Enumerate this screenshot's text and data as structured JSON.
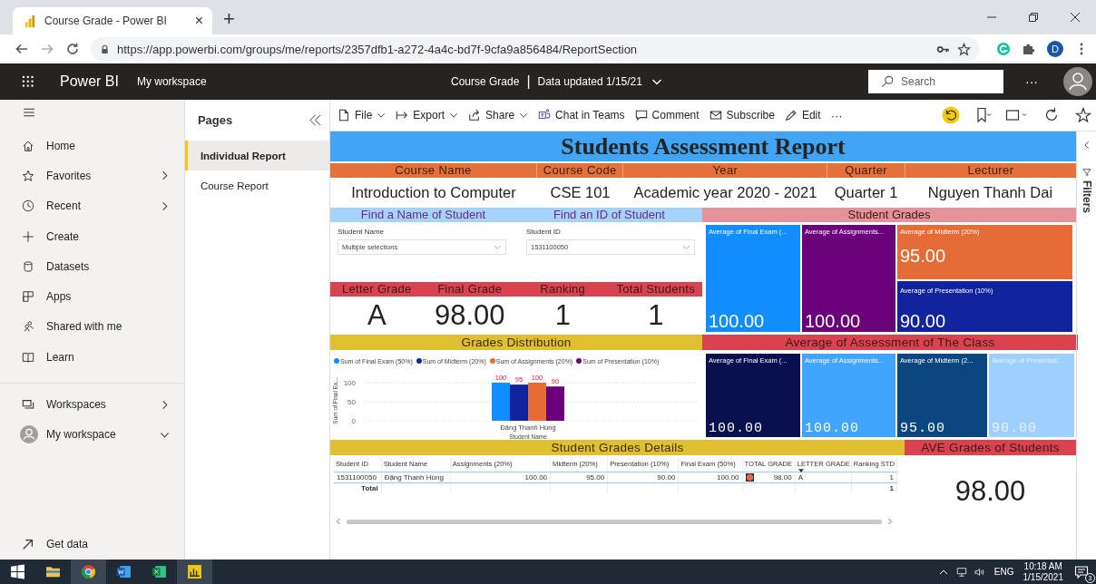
{
  "browser": {
    "tab_title": "Course Grade - Power BI",
    "tab_close": "×",
    "new_tab": "+",
    "url": "https://app.powerbi.com/groups/me/reports/2357dfb1-a272-4a4c-bd7f-9cfa9a856484/ReportSection",
    "profile_initial": "D"
  },
  "header": {
    "app_name": "Power BI",
    "workspace": "My workspace",
    "report_name": "Course Grade",
    "separator": "|",
    "data_updated": "Data updated 1/15/21",
    "search": {
      "placeholder": "Search"
    },
    "more": "···"
  },
  "nav": {
    "items": [
      {
        "label": "Home",
        "expandable": false
      },
      {
        "label": "Favorites",
        "expandable": true
      },
      {
        "label": "Recent",
        "expandable": true
      },
      {
        "label": "Create",
        "expandable": false
      },
      {
        "label": "Datasets",
        "expandable": false
      },
      {
        "label": "Apps",
        "expandable": false
      },
      {
        "label": "Shared with me",
        "expandable": false
      },
      {
        "label": "Learn",
        "expandable": false
      }
    ],
    "workspace_items": [
      {
        "label": "Workspaces",
        "expanded": false
      },
      {
        "label": "My workspace",
        "expanded": true
      }
    ],
    "footer": "Get data"
  },
  "pages": {
    "title": "Pages",
    "items": [
      {
        "label": "Individual Report",
        "selected": true
      },
      {
        "label": "Course Report",
        "selected": false
      }
    ]
  },
  "toolbar": {
    "items": [
      {
        "label": "File",
        "dropdown": true
      },
      {
        "label": "Export",
        "dropdown": true
      },
      {
        "label": "Share",
        "dropdown": true
      },
      {
        "label": "Chat in Teams",
        "dropdown": false
      },
      {
        "label": "Comment",
        "dropdown": false
      },
      {
        "label": "Subscribe",
        "dropdown": false
      },
      {
        "label": "Edit",
        "dropdown": false
      }
    ],
    "more": "···"
  },
  "filters_pane": {
    "label": "Filters"
  },
  "report": {
    "title": "Students Assessment Report",
    "course_info": [
      {
        "heading": "Course Name",
        "value": "Introduction to Computer"
      },
      {
        "heading": "Course Code",
        "value": "CSE 101"
      },
      {
        "heading": "Year",
        "value": "Academic year 2020 - 2021"
      },
      {
        "heading": "Quarter",
        "value": "Quarter 1"
      },
      {
        "heading": "Lecturer",
        "value": "Nguyen Thanh Dai"
      }
    ],
    "slicers": [
      {
        "heading": "Find a Name of Student",
        "label": "Student Name",
        "value": "Multiple selections"
      },
      {
        "heading": "Find an ID of Student",
        "label": "Student ID",
        "value": "1531100050"
      }
    ],
    "cards": [
      {
        "heading": "Letter Grade",
        "value": "A"
      },
      {
        "heading": "Final Grade",
        "value": "98.00"
      },
      {
        "heading": "Ranking",
        "value": "1"
      },
      {
        "heading": "Total Students",
        "value": "1"
      }
    ],
    "student_grades": {
      "heading": "Student Grades",
      "tiles": [
        {
          "label": "Average of Final Exam (...",
          "value": "100.00",
          "color": "#118dff"
        },
        {
          "label": "Average of Assignments...",
          "value": "100.00",
          "color": "#6b007b"
        },
        {
          "label": "Average of Midterm (20%)",
          "value": "95.00",
          "color": "#e66c37"
        },
        {
          "label": "Average of Presentation (10%)",
          "value": "90.00",
          "color": "#12239e"
        }
      ]
    },
    "distribution": {
      "heading": "Grades Distribution",
      "chart_data": {
        "type": "bar",
        "legend": "top",
        "xlabel": "Student Name",
        "ylabel": "Sum of Final Ex...",
        "categories": [
          "Đặng Thanh Hùng"
        ],
        "ylim": [
          0,
          100
        ],
        "yticks": [
          0,
          50,
          100
        ],
        "data_labels": true,
        "series": [
          {
            "name": "Sum of Final Exam (50%)",
            "color": "#118dff",
            "values": [
              100
            ]
          },
          {
            "name": "Sum of Midterm (20%)",
            "color": "#12239e",
            "values": [
              95
            ]
          },
          {
            "name": "Sum of Assignments (20%)",
            "color": "#e66c37",
            "values": [
              100
            ]
          },
          {
            "name": "Sum of Presentation (10%)",
            "color": "#6b007b",
            "values": [
              90
            ]
          }
        ]
      }
    },
    "class_average": {
      "heading": "Average of Assessment of The Class",
      "tiles": [
        {
          "label": "Average of Final Exam (...",
          "value": "100.00",
          "color": "#0a0f4f"
        },
        {
          "label": "Average of Assignments...",
          "value": "100.00",
          "color": "#41a4ff"
        },
        {
          "label": "Average of Midterm (2...",
          "value": "95.00",
          "color": "#0c4680"
        },
        {
          "label": "Average of Presentati...",
          "value": "90.00",
          "color": "#9fcfff"
        }
      ]
    },
    "details": {
      "heading": "Student Grades Details",
      "columns": [
        {
          "label": "Student ID",
          "sorted": false
        },
        {
          "label": "Student Name",
          "sorted": false
        },
        {
          "label": "Assignments (20%)",
          "sorted": false
        },
        {
          "label": "Midterm (20%)",
          "sorted": false
        },
        {
          "label": "Presentation (10%)",
          "sorted": false
        },
        {
          "label": "Final Exam (50%)",
          "sorted": false
        },
        {
          "label": "TOTAL GRADE",
          "sorted": false
        },
        {
          "label": "LETTER GRADE",
          "sorted": true
        },
        {
          "label": "Ranking STD",
          "sorted": false
        }
      ],
      "rows": [
        {
          "cells": [
            "1531100050",
            "Đặng Thanh Hùng",
            "100.00",
            "95.00",
            "90.00",
            "100.00",
            "98.00",
            "A",
            "1"
          ],
          "color": "#e8684a"
        }
      ],
      "total": {
        "label": "Total",
        "ranking": "1"
      }
    },
    "ave": {
      "heading": "AVE Grades of Students",
      "value": "98.00"
    }
  },
  "taskbar": {
    "language": "ENG",
    "time": "10:18 AM",
    "date": "1/15/2021",
    "notifications": "3"
  }
}
